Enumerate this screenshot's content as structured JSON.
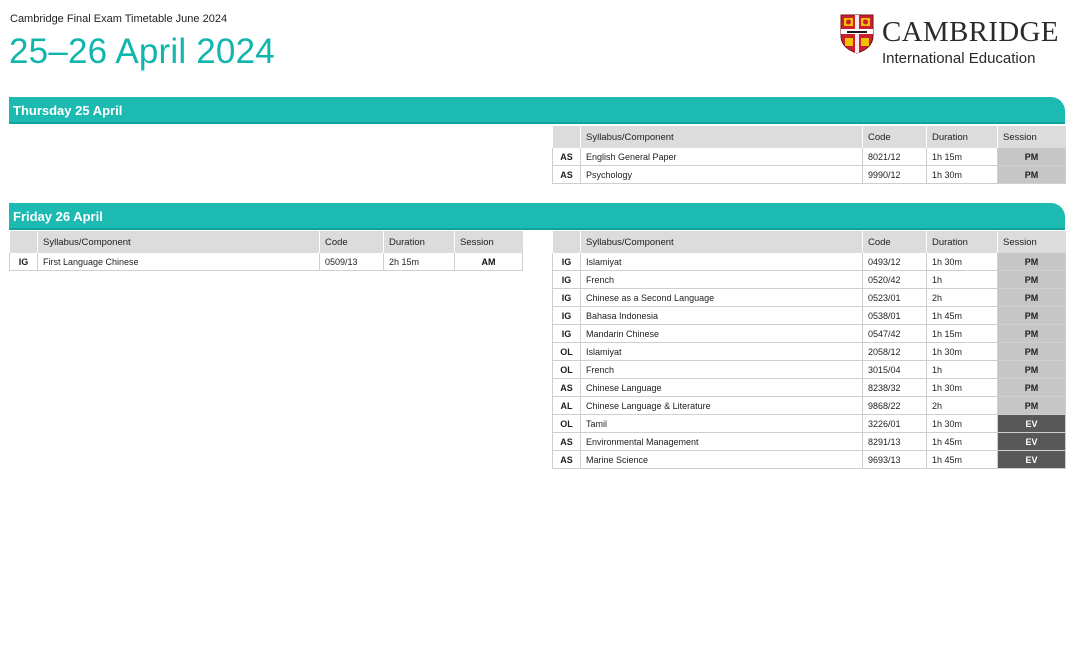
{
  "header": {
    "subtitle": "Cambridge Final Exam Timetable June 2024",
    "title": "25–26 April 2024"
  },
  "logo": {
    "wordmark": "CAMBRIDGE",
    "sub": "International Education",
    "shield_icon": "cambridge-shield-icon",
    "colors": {
      "red": "#c8202f",
      "gold": "#f2c200"
    }
  },
  "colors": {
    "accent": "#1dbab2",
    "title": "#10b6ac",
    "header_cell": "#dcdcdc",
    "pm": "#c6c6c6",
    "ev": "#585858"
  },
  "columns": {
    "syllabus": "Syllabus/Component",
    "code": "Code",
    "duration": "Duration",
    "session": "Session"
  },
  "days": [
    {
      "label": "Thursday 25 April",
      "left_rows": [],
      "right_rows": [
        {
          "level": "AS",
          "syllabus": "English General Paper",
          "code": "8021/12",
          "duration": "1h 15m",
          "session": "PM"
        },
        {
          "level": "AS",
          "syllabus": "Psychology",
          "code": "9990/12",
          "duration": "1h 30m",
          "session": "PM"
        }
      ]
    },
    {
      "label": "Friday 26 April",
      "left_rows": [
        {
          "level": "IG",
          "syllabus": "First Language Chinese",
          "code": "0509/13",
          "duration": "2h 15m",
          "session": "AM"
        }
      ],
      "right_rows": [
        {
          "level": "IG",
          "syllabus": "Islamiyat",
          "code": "0493/12",
          "duration": "1h 30m",
          "session": "PM"
        },
        {
          "level": "IG",
          "syllabus": "French",
          "code": "0520/42",
          "duration": "1h",
          "session": "PM"
        },
        {
          "level": "IG",
          "syllabus": "Chinese as a Second Language",
          "code": "0523/01",
          "duration": "2h",
          "session": "PM"
        },
        {
          "level": "IG",
          "syllabus": "Bahasa Indonesia",
          "code": "0538/01",
          "duration": "1h 45m",
          "session": "PM"
        },
        {
          "level": "IG",
          "syllabus": "Mandarin Chinese",
          "code": "0547/42",
          "duration": "1h 15m",
          "session": "PM"
        },
        {
          "level": "OL",
          "syllabus": "Islamiyat",
          "code": "2058/12",
          "duration": "1h 30m",
          "session": "PM"
        },
        {
          "level": "OL",
          "syllabus": "French",
          "code": "3015/04",
          "duration": "1h",
          "session": "PM"
        },
        {
          "level": "AS",
          "syllabus": "Chinese Language",
          "code": "8238/32",
          "duration": "1h 30m",
          "session": "PM"
        },
        {
          "level": "AL",
          "syllabus": "Chinese Language & Literature",
          "code": "9868/22",
          "duration": "2h",
          "session": "PM"
        },
        {
          "level": "OL",
          "syllabus": "Tamil",
          "code": "3226/01",
          "duration": "1h 30m",
          "session": "EV"
        },
        {
          "level": "AS",
          "syllabus": "Environmental Management",
          "code": "8291/13",
          "duration": "1h 45m",
          "session": "EV"
        },
        {
          "level": "AS",
          "syllabus": "Marine Science",
          "code": "9693/13",
          "duration": "1h 45m",
          "session": "EV"
        }
      ]
    }
  ]
}
